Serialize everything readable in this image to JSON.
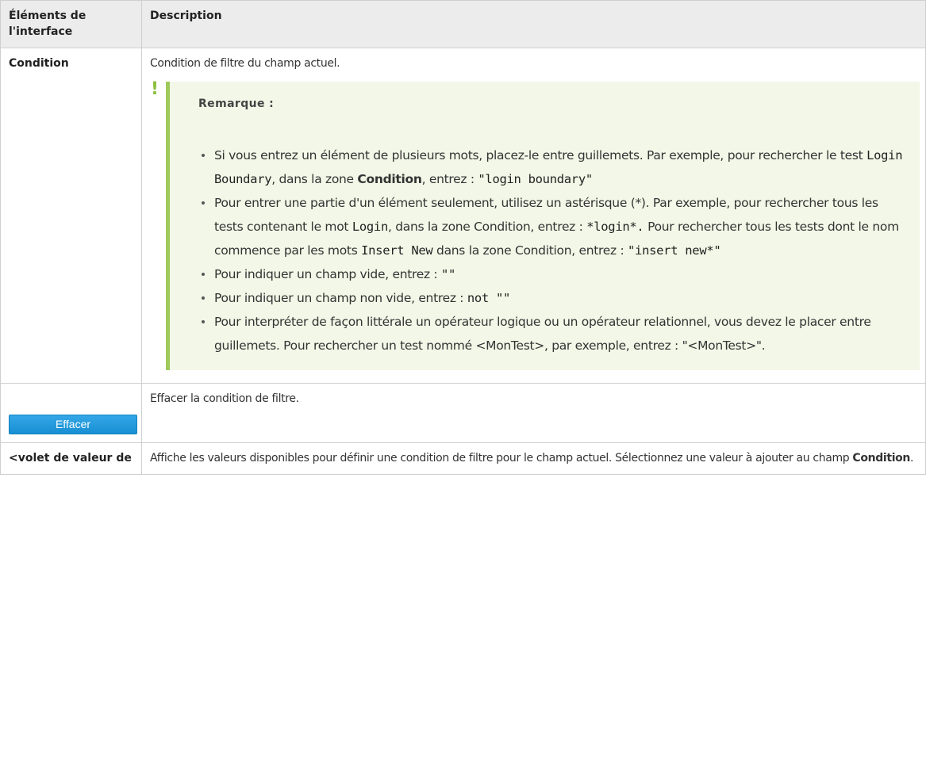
{
  "table": {
    "headers": {
      "element": "Éléments de l'interface",
      "description": "Description"
    },
    "rows": [
      {
        "element": "Condition",
        "description": "Condition de filtre du champ actuel.",
        "note": {
          "title": "Remarque :",
          "items": [
            {
              "p1": "Si vous entrez un élément de plusieurs mots, placez-le entre guillemets. Par exemple, pour rechercher le test ",
              "c1": "Login Boundary",
              "p2": ", dans la zone ",
              "b1": "Condition",
              "p3": ", entrez : ",
              "c2": "\"login boundary\""
            },
            {
              "p1": "Pour entrer une partie d'un élément seulement, utilisez un astérisque (*). Par exemple, pour rechercher tous les tests contenant le mot ",
              "c1": "Login",
              "p2": ", dans la zone Condition, entrez : ",
              "c2": "*login*.",
              "p3": " Pour rechercher tous les tests dont le nom commence par les mots ",
              "c3": "Insert New",
              "p4": " dans la zone Condition, entrez : ",
              "c4": "\"insert new*\""
            },
            {
              "p1": "Pour indiquer un champ vide, entrez : ",
              "c1": "\"\""
            },
            {
              "p1": "Pour indiquer un champ non vide, entrez : ",
              "c1": "not \"\""
            },
            {
              "p1": "Pour interpréter de façon littérale un opérateur logique ou un opérateur relationnel, vous devez le placer entre guillemets. Pour rechercher un test nommé <MonTest>, par exemple, entrez : \"<MonTest>\"."
            }
          ]
        }
      },
      {
        "element_button": "Effacer",
        "description": "Effacer la condition de filtre."
      },
      {
        "element": "<volet de valeur de",
        "description_p1": "Affiche les valeurs disponibles pour définir une condition de filtre pour le champ actuel. Sélectionnez une valeur à ajouter au champ ",
        "description_b1": "Condition",
        "description_p2": "."
      }
    ]
  },
  "colors": {
    "note_background": "#f2f7e7",
    "note_accent": "#9fca5b",
    "button_blue": "#1e96da",
    "header_background": "#ececec"
  },
  "icons": {
    "note_marker": "exclamation-icon"
  }
}
